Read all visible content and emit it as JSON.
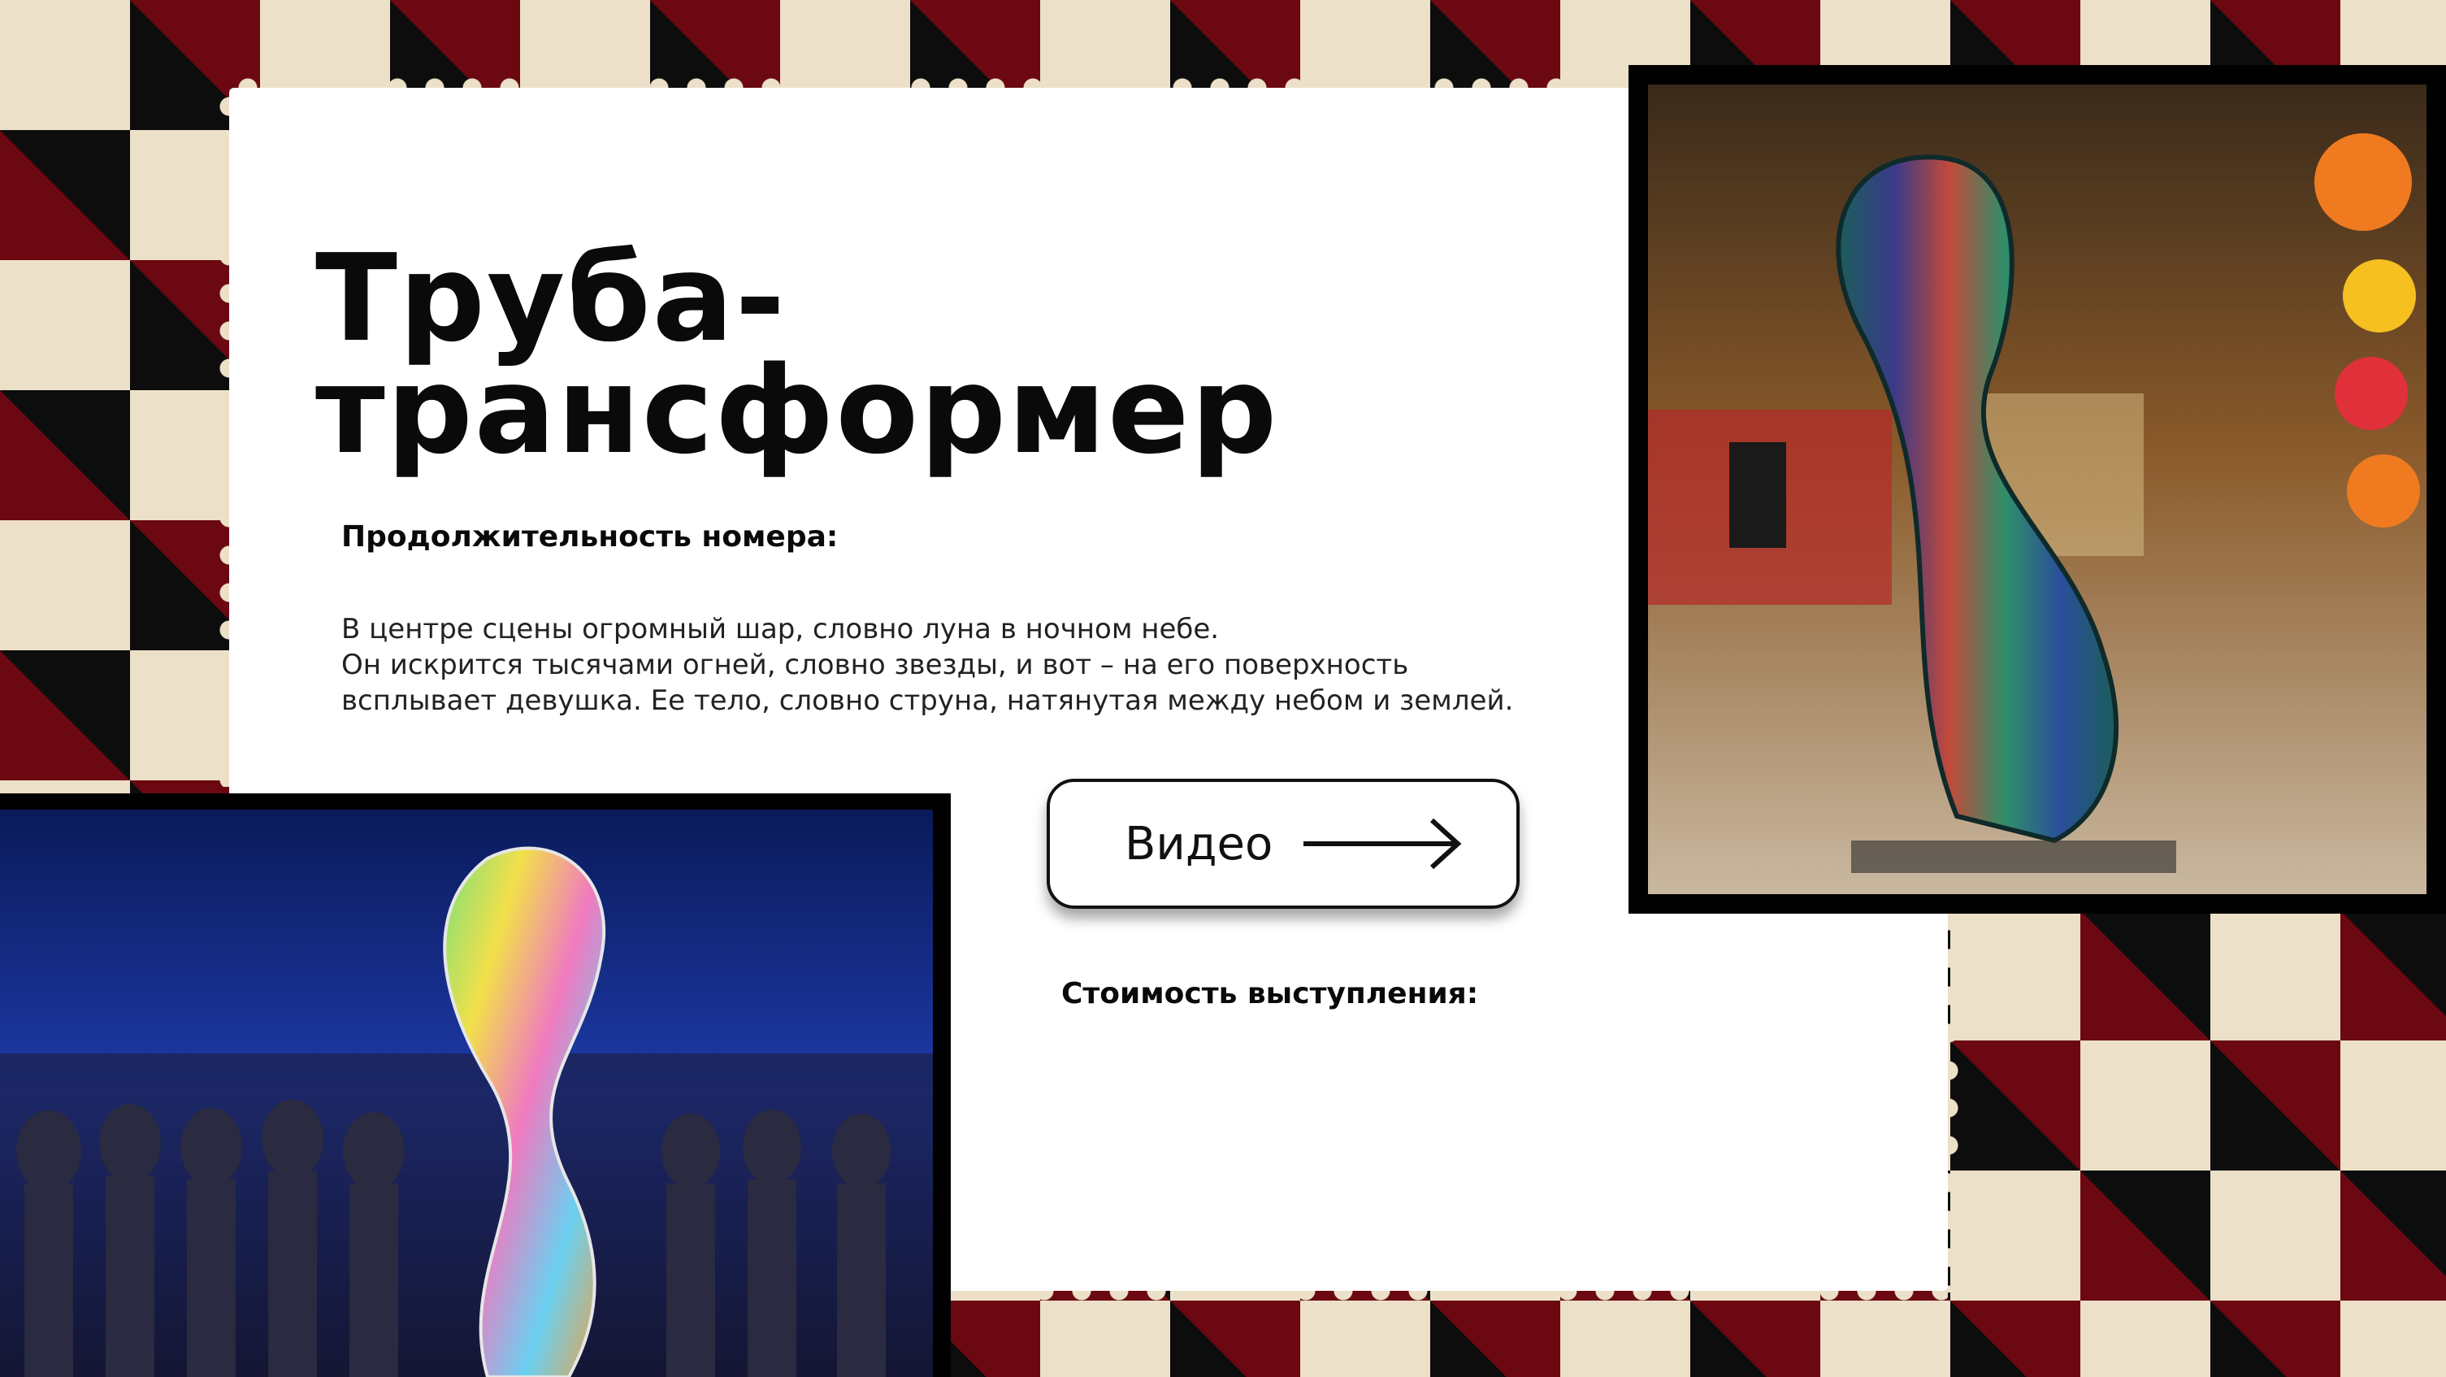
{
  "title": {
    "line1": "Труба-",
    "line2": "трансформер"
  },
  "duration_label": "Продолжительность номера:",
  "description": {
    "line1": "В центре сцены огромный шар, словно луна в ночном небе.",
    "line2": "Он искрится тысячами огней, словно звезды, и вот – на его поверхность",
    "line3": "всплывает девушка. Ее тело, словно струна, натянутая между небом и землей."
  },
  "video_button": {
    "label": "Видео",
    "icon": "arrow-right-icon"
  },
  "cost_label": "Стоимость выступления:",
  "images": {
    "right": "performer-in-striped-tube-costume-mall-photo",
    "left": "performer-in-rainbow-tube-costume-club-photo"
  },
  "colors": {
    "accent_red": "#6b0812",
    "cream": "#ece0c8",
    "black": "#0d0d0d"
  }
}
